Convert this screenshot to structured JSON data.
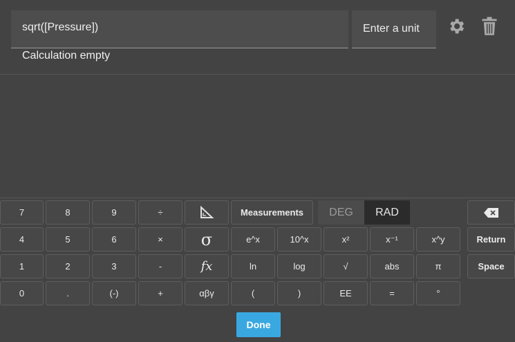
{
  "expression": {
    "value": "sqrt([Pressure])"
  },
  "unit": {
    "placeholder": "Enter a unit"
  },
  "status": "Calculation empty",
  "angle_mode": {
    "deg": "DEG",
    "rad": "RAD",
    "selected": "RAD"
  },
  "keys": {
    "n7": "7",
    "n8": "8",
    "n9": "9",
    "divide": "÷",
    "measurements": "Measurements",
    "n4": "4",
    "n5": "5",
    "n6": "6",
    "multiply": "×",
    "exp": "e^x",
    "pow10": "10^x",
    "square": "x²",
    "reciprocal": "x⁻¹",
    "power": "x^y",
    "return": "Return",
    "n1": "1",
    "n2": "2",
    "n3": "3",
    "minus": "-",
    "fx": "fx",
    "ln": "ln",
    "log": "log",
    "sqrt": "√",
    "abs": "abs",
    "pi": "π",
    "space": "Space",
    "n0": "0",
    "dot": ".",
    "negate": "(-)",
    "plus": "+",
    "greek": "αβγ",
    "lparen": "(",
    "rparen": ")",
    "ee": "EE",
    "equals": "=",
    "degree": "°",
    "sigma": "σ"
  },
  "done": "Done"
}
